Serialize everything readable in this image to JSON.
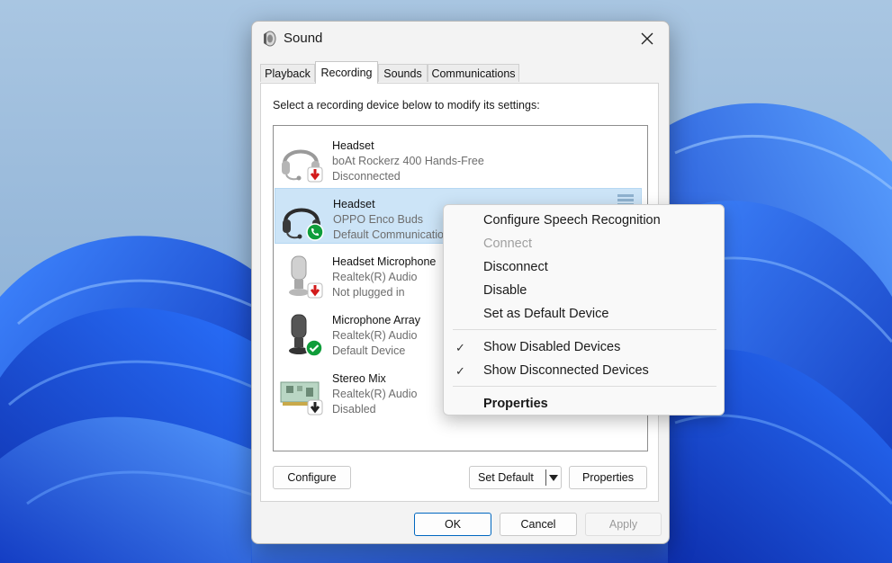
{
  "window": {
    "title": "Sound",
    "close_label": "Close"
  },
  "tabs": [
    {
      "label": "Playback",
      "active": false
    },
    {
      "label": "Recording",
      "active": true
    },
    {
      "label": "Sounds",
      "active": false
    },
    {
      "label": "Communications",
      "active": false
    }
  ],
  "instructions": "Select a recording device below to modify its settings:",
  "devices": [
    {
      "name": "Headset",
      "description": "boAt Rockerz 400 Hands-Free",
      "status": "Disconnected",
      "icon": "headset-icon",
      "badge": "red-down-arrow",
      "selected": false
    },
    {
      "name": "Headset",
      "description": "OPPO Enco Buds",
      "status": "Default Communications Device",
      "icon": "headset-icon",
      "badge": "green-phone",
      "selected": true
    },
    {
      "name": "Headset Microphone",
      "description": "Realtek(R) Audio",
      "status": "Not plugged in",
      "icon": "microphone-icon",
      "badge": "red-down-arrow",
      "selected": false
    },
    {
      "name": "Microphone Array",
      "description": "Realtek(R) Audio",
      "status": "Default Device",
      "icon": "microphone-icon",
      "badge": "green-check",
      "selected": false
    },
    {
      "name": "Stereo Mix",
      "description": "Realtek(R) Audio",
      "status": "Disabled",
      "icon": "sound-card-icon",
      "badge": "black-down-arrow",
      "selected": false
    }
  ],
  "buttons": {
    "configure": "Configure",
    "set_default": "Set Default",
    "properties": "Properties",
    "ok": "OK",
    "cancel": "Cancel",
    "apply": "Apply"
  },
  "context_menu": {
    "items": [
      {
        "label": "Configure Speech Recognition",
        "enabled": true,
        "checked": false,
        "bold": false
      },
      {
        "label": "Connect",
        "enabled": false,
        "checked": false,
        "bold": false
      },
      {
        "label": "Disconnect",
        "enabled": true,
        "checked": false,
        "bold": false
      },
      {
        "label": "Disable",
        "enabled": true,
        "checked": false,
        "bold": false
      },
      {
        "label": "Set as Default Device",
        "enabled": true,
        "checked": false,
        "bold": false
      },
      {
        "label": "Show Disabled Devices",
        "enabled": true,
        "checked": true,
        "bold": false
      },
      {
        "label": "Show Disconnected Devices",
        "enabled": true,
        "checked": true,
        "bold": false
      },
      {
        "label": "Properties",
        "enabled": true,
        "checked": false,
        "bold": true
      }
    ]
  },
  "colors": {
    "accent": "#0067c0",
    "selection": "#cce4f7",
    "wallpaper_blue": "#1a4fd6"
  }
}
